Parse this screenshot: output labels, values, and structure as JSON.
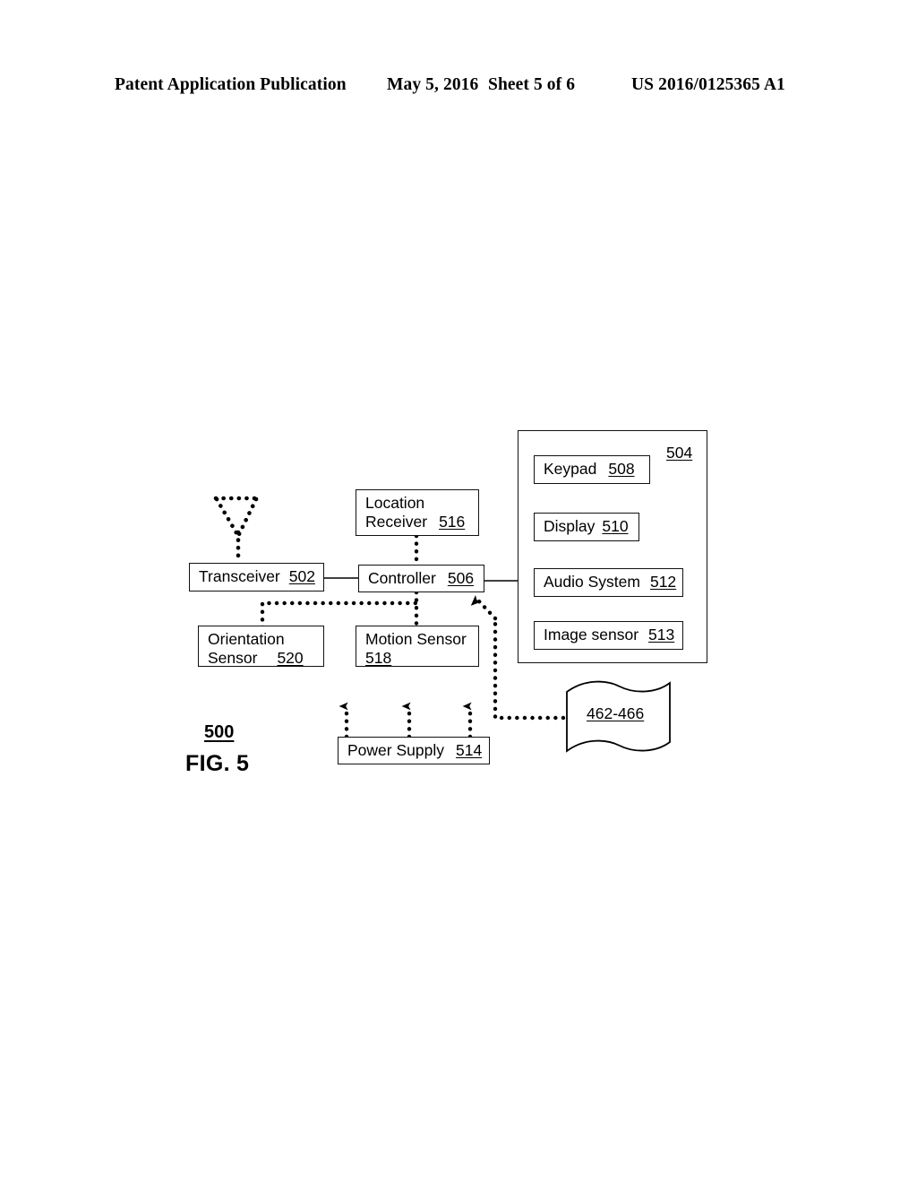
{
  "header": {
    "publication": "Patent Application Publication",
    "date": "May 5, 2016",
    "sheet": "Sheet 5 of 6",
    "patent_number": "US 2016/0125365 A1"
  },
  "figure": {
    "caption": "FIG. 5",
    "system_ref": "500",
    "container": {
      "ref": "504"
    },
    "banner": {
      "ref": "462-466"
    },
    "blocks": [
      {
        "id": "transceiver",
        "label": "Transceiver",
        "ref": "502",
        "lines": 1
      },
      {
        "id": "controller",
        "label": "Controller",
        "ref": "506",
        "lines": 1
      },
      {
        "id": "location-receiver",
        "label_line1": "Location",
        "label_line2": "Receiver",
        "ref": "516",
        "lines": 2
      },
      {
        "id": "orientation-sensor",
        "label_line1": "Orientation",
        "label_line2": "Sensor",
        "ref": "520",
        "lines": 2
      },
      {
        "id": "motion-sensor",
        "label_line1": "Motion Sensor",
        "label_line2": "",
        "ref": "518",
        "lines": 2
      },
      {
        "id": "power-supply",
        "label": "Power Supply",
        "ref": "514",
        "lines": 1
      },
      {
        "id": "keypad",
        "label": "Keypad",
        "ref": "508",
        "lines": 1
      },
      {
        "id": "display",
        "label": "Display",
        "ref": "510",
        "lines": 1
      },
      {
        "id": "audio-system",
        "label": "Audio System",
        "ref": "512",
        "lines": 1
      },
      {
        "id": "image-sensor",
        "label": "Image sensor",
        "ref": "513",
        "lines": 1
      }
    ]
  },
  "colors": {
    "ink": "#000000",
    "paper": "#ffffff"
  }
}
